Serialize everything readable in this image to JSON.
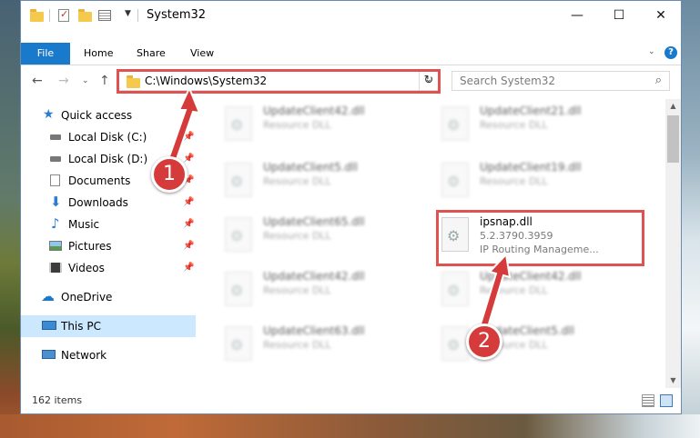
{
  "window": {
    "title": "System32",
    "minimize_label": "—",
    "maximize_label": "☐",
    "close_label": "✕"
  },
  "ribbon": {
    "file": "File",
    "home": "Home",
    "share": "Share",
    "view": "View",
    "help": "?"
  },
  "address": {
    "path": "C:\\Windows\\System32",
    "search_placeholder": "Search System32"
  },
  "nav": {
    "items": [
      {
        "label": "Quick access",
        "icon": "star-icon"
      },
      {
        "label": "Local Disk (C:)",
        "icon": "drive-icon"
      },
      {
        "label": "Local Disk (D:)",
        "icon": "drive-icon"
      },
      {
        "label": "Documents",
        "icon": "documents-icon"
      },
      {
        "label": "Downloads",
        "icon": "download-icon"
      },
      {
        "label": "Music",
        "icon": "music-icon"
      },
      {
        "label": "Pictures",
        "icon": "pictures-icon"
      },
      {
        "label": "Videos",
        "icon": "videos-icon"
      },
      {
        "label": "OneDrive",
        "icon": "cloud-icon"
      },
      {
        "label": "This PC",
        "icon": "computer-icon"
      },
      {
        "label": "Network",
        "icon": "network-icon"
      }
    ]
  },
  "files": [
    {
      "name": "UpdateClient42.dll",
      "type": "Resource DLL"
    },
    {
      "name": "UpdateClient21.dll",
      "type": "Resource DLL"
    },
    {
      "name": "UpdateClient5.dll",
      "type": "Resource DLL"
    },
    {
      "name": "UpdateClient19.dll",
      "type": "Resource DLL"
    },
    {
      "name": "UpdateClient65.dll",
      "type": "Resource DLL"
    },
    {
      "name": "ipsnap.dll",
      "version": "5.2.3790.3959",
      "description": "IP Routing Manageme..."
    },
    {
      "name": "UpdateClient42.dll",
      "type": "Resource DLL"
    },
    {
      "name": "UpdateClient42.dll",
      "type": "Resource DLL"
    },
    {
      "name": "UpdateClient63.dll",
      "type": "Resource DLL"
    },
    {
      "name": "UpdateClient5.dll",
      "type": "Resource DLL"
    }
  ],
  "status": {
    "item_count": "162 items"
  },
  "callouts": {
    "one": "1",
    "two": "2"
  },
  "colors": {
    "accent": "#1979ca",
    "highlight": "#e05252",
    "selected": "#cce8ff"
  }
}
